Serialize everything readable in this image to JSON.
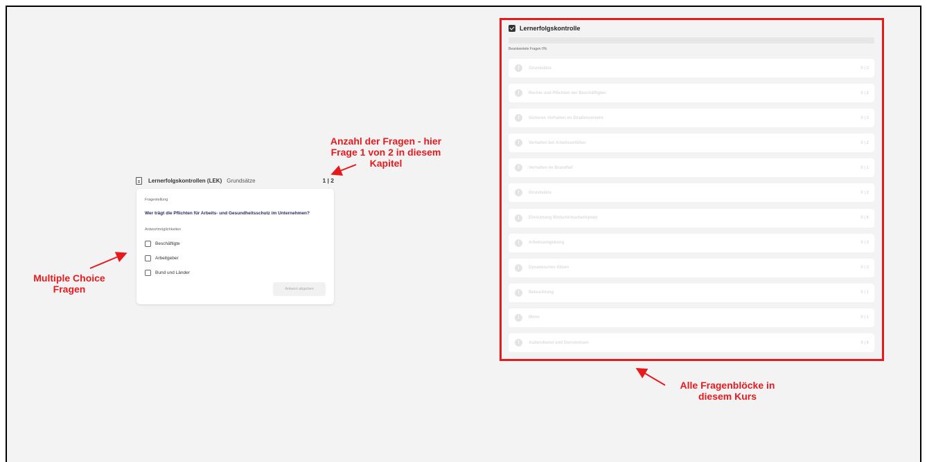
{
  "lek": {
    "title": "Lernerfolgskontrollen (LEK)",
    "chapter": "Grundsätze",
    "counter": "1 | 2",
    "question_label": "Fragestellung",
    "question": "Wer trägt die Pflichten für Arbeits- und Gesundheitsschutz im Unternehmen?",
    "answers_label": "Antwortmöglichkeiten",
    "options": [
      "Beschäftigte",
      "Arbeitgeber",
      "Bund und Länder"
    ],
    "submit_label": "Antwort abgeben"
  },
  "panel": {
    "title": "Lernerfolgskontrolle",
    "progress_label": "Beantwortete Fragen 0%",
    "progress_percent": 0,
    "blocks": [
      {
        "title": "Grundsätze",
        "count": "0 | 2"
      },
      {
        "title": "Rechte und Pflichten der Beschäftigten",
        "count": "0 | 2"
      },
      {
        "title": "Sicheres Verhalten im Straßenverkehr",
        "count": "0 | 3"
      },
      {
        "title": "Verhalten bei Arbeitsunfällen",
        "count": "0 | 2"
      },
      {
        "title": "Verhalten im Brandfall",
        "count": "0 | 1"
      },
      {
        "title": "Grundsätze",
        "count": "0 | 2"
      },
      {
        "title": "Einrichtung Bildschirmarbeitsplatz",
        "count": "0 | 6"
      },
      {
        "title": "Arbeitsumgebung",
        "count": "0 | 3"
      },
      {
        "title": "Dynamisches Sitzen",
        "count": "0 | 2"
      },
      {
        "title": "Beleuchtung",
        "count": "0 | 1"
      },
      {
        "title": "Mimo",
        "count": "0 | 1"
      },
      {
        "title": "Außendienst und Dienstreisen",
        "count": "0 | 6"
      }
    ]
  },
  "annotations": {
    "questions_count_line1": "Anzahl der Fragen - hier",
    "questions_count_line2": "Frage 1 von 2 in diesem",
    "questions_count_line3": "Kapitel",
    "multiple_choice_line1": "Multiple Choice",
    "multiple_choice_line2": "Fragen",
    "all_blocks_line1": "Alle Fragenblöcke in",
    "all_blocks_line2": "diesem Kurs"
  },
  "colors": {
    "annotation_red": "#e8191d",
    "question_text": "#1f2a5a"
  }
}
